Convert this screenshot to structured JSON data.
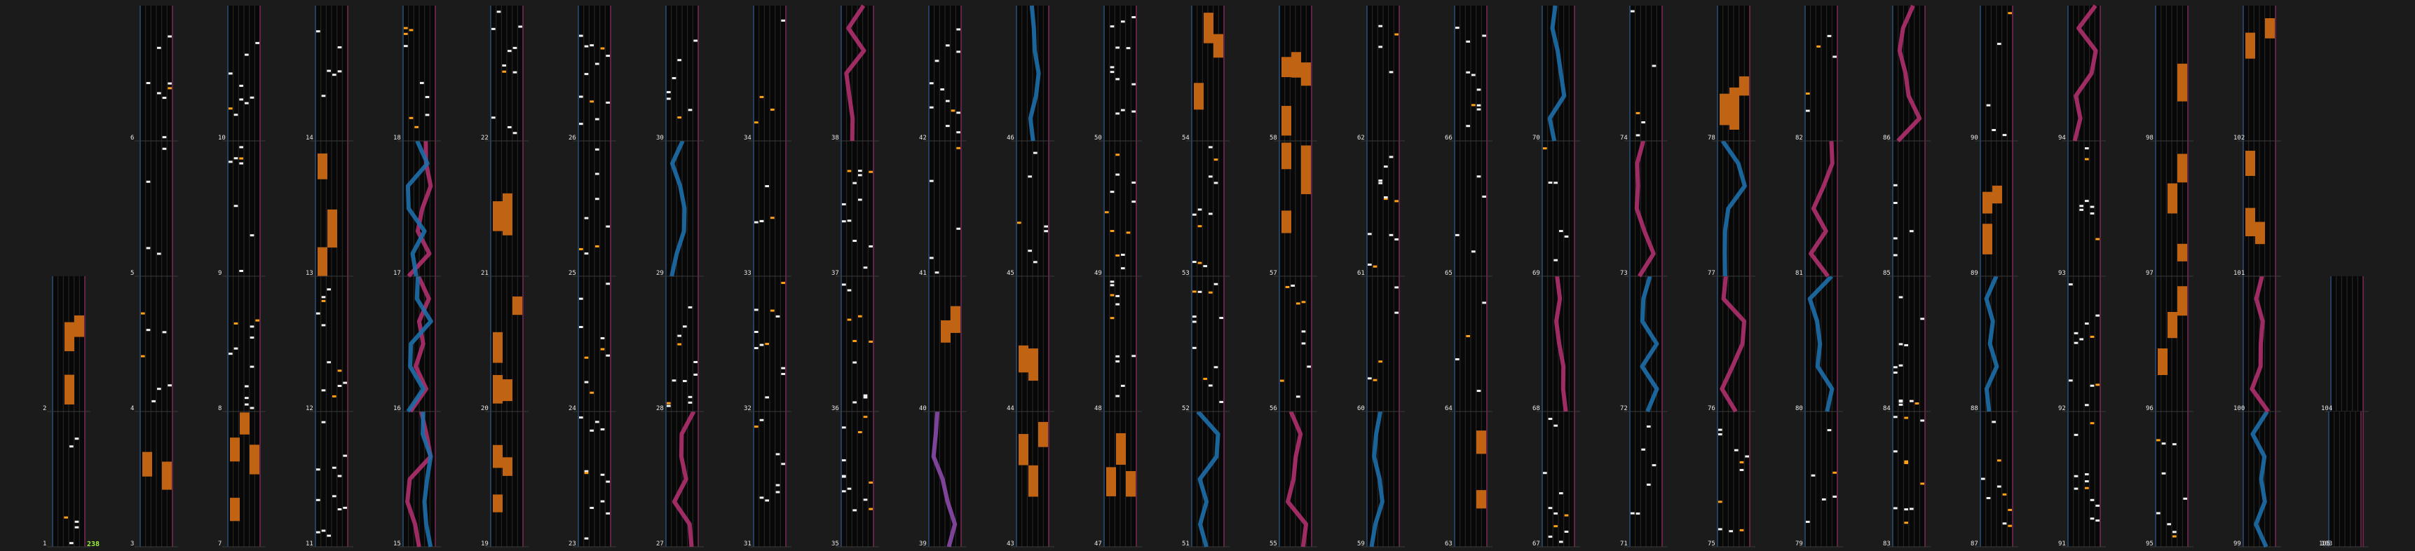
{
  "combo_label": "238",
  "colors": {
    "background": "#1b1b1b",
    "lane_bg": "#080808",
    "lane_line": "#2a2a2a",
    "lane_border_left": "#2b4f7a",
    "lane_border_right": "#7a2b57",
    "measure_line": "#3a3a3a",
    "note_white": "#f2f2f2",
    "note_orange": "#ffa018",
    "hold_orange": "#c06414",
    "slide_blue": "#1e6faa",
    "slide_magenta": "#b0306e",
    "slide_purple": "#8a4aa8",
    "combo_green": "#9cf03c"
  },
  "chart_data": {
    "type": "rhythm-game-chart",
    "first_measure": 1,
    "last_measure": 105,
    "measures_per_column": 4,
    "lanes": 6,
    "combo": 238,
    "measure_sections": [
      {
        "m": 1,
        "content": "notes"
      },
      {
        "m": 2,
        "content": "notes"
      },
      {
        "m": 15,
        "content": "slide-blue-magenta"
      },
      {
        "m": 16,
        "content": "slide-blue-magenta"
      },
      {
        "m": 17,
        "content": "slide-blue-magenta"
      },
      {
        "m": 27,
        "content": "slide-magenta"
      },
      {
        "m": 29,
        "content": "slide-blue"
      },
      {
        "m": 38,
        "content": "slide-magenta"
      },
      {
        "m": 39,
        "content": "slide-purple"
      },
      {
        "m": 46,
        "content": "slide-blue"
      },
      {
        "m": 51,
        "content": "slide-blue"
      },
      {
        "m": 55,
        "content": "slide-magenta"
      },
      {
        "m": 59,
        "content": "slide-blue"
      },
      {
        "m": 68,
        "content": "slide-magenta"
      },
      {
        "m": 70,
        "content": "slide-blue"
      },
      {
        "m": 72,
        "content": "slide-blue"
      },
      {
        "m": 73,
        "content": "slide-magenta"
      },
      {
        "m": 76,
        "content": "slide-magenta"
      },
      {
        "m": 77,
        "content": "slide-blue"
      },
      {
        "m": 80,
        "content": "slide-blue"
      },
      {
        "m": 81,
        "content": "slide-magenta"
      },
      {
        "m": 86,
        "content": "slide-magenta"
      },
      {
        "m": 88,
        "content": "slide-blue"
      },
      {
        "m": 94,
        "content": "slide-magenta"
      },
      {
        "m": 99,
        "content": "slide-blue"
      },
      {
        "m": 100,
        "content": "slide-magenta"
      }
    ]
  }
}
